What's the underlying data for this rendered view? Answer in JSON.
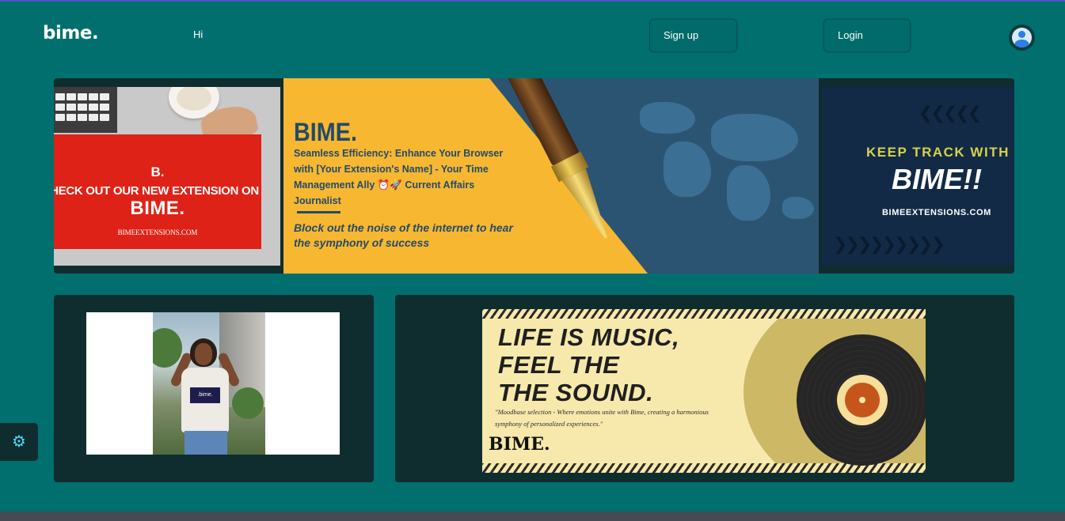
{
  "header": {
    "logo": "bime.",
    "greeting": "Hi",
    "signup_label": "Sign up",
    "login_label": "Login"
  },
  "banner": {
    "slide1": {
      "mark": "B.",
      "headline": "HECK OUT OUR NEW EXTENSION ON",
      "brand": "BIME.",
      "url": "BIMEEXTENSIONS.COM"
    },
    "slide2": {
      "title": "BIME.",
      "text": "Seamless Efficiency: Enhance Your Browser with [Your Extension's Name] - Your Time Management Ally ⏰🚀 Current Affairs Journalist",
      "subtitle": "Block out the noise of the internet to hear the symphony of success"
    },
    "slide3": {
      "keep": "KEEP TRACK WITH",
      "brand": "BIME!!",
      "url": "BIMEEXTENSIONS.COM"
    }
  },
  "promo_left": {
    "shirt_logo": ".bime."
  },
  "promo_right": {
    "title_line1": "LIFE IS MUSIC,",
    "title_line2": "FEEL THE",
    "title_line3": "THE SOUND.",
    "quote": "\"Moodbase selection - Where emotions unite with Bime, creating a harmonious symphony of personalized experiences.\"",
    "brand": "BIME."
  },
  "icons": {
    "avatar": "user-avatar-icon",
    "settings": "gear-icon"
  },
  "colors": {
    "background": "#006f6e",
    "panel": "#0f2d2f",
    "accent_cyan": "#4ed8f0"
  }
}
